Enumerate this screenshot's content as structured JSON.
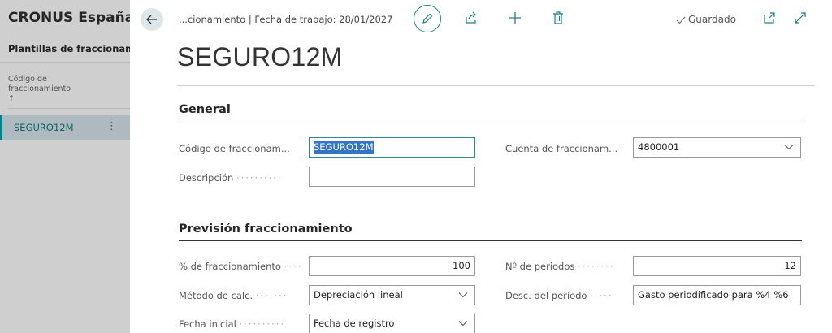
{
  "background": {
    "company": "CRONUS España",
    "list_title": "Plantillas de fraccionamiento",
    "column_header": "Código de fraccionamiento",
    "sort_arrow": "↑",
    "row_value": "SEGURO12M",
    "row_menu": "⋮"
  },
  "header": {
    "breadcrumb": "...cionamiento | Fecha de trabajo: 28/01/2027",
    "saved_label": "Guardado",
    "title": "SEGURO12M"
  },
  "sections": {
    "general": {
      "title": "General",
      "code_label": "Código de fraccionam...",
      "code_value": "SEGURO12M",
      "description_label": "Descripción",
      "description_value": "",
      "account_label": "Cuenta de fraccionam...",
      "account_value": "4800001"
    },
    "forecast": {
      "title": "Previsión fraccionamiento",
      "percent_label": "% de fraccionamiento",
      "percent_value": "100",
      "periods_label": "Nº de periodos",
      "periods_value": "12",
      "method_label": "Método de calc.",
      "method_value": "Depreciación lineal",
      "period_desc_label": "Desc. del período",
      "period_desc_value": "Gasto periodificado para %4 %6",
      "start_date_label": "Fecha inicial",
      "start_date_value": "Fecha de registro"
    }
  },
  "colors": {
    "accent": "#1d7f86",
    "selection": "#3374c7"
  }
}
